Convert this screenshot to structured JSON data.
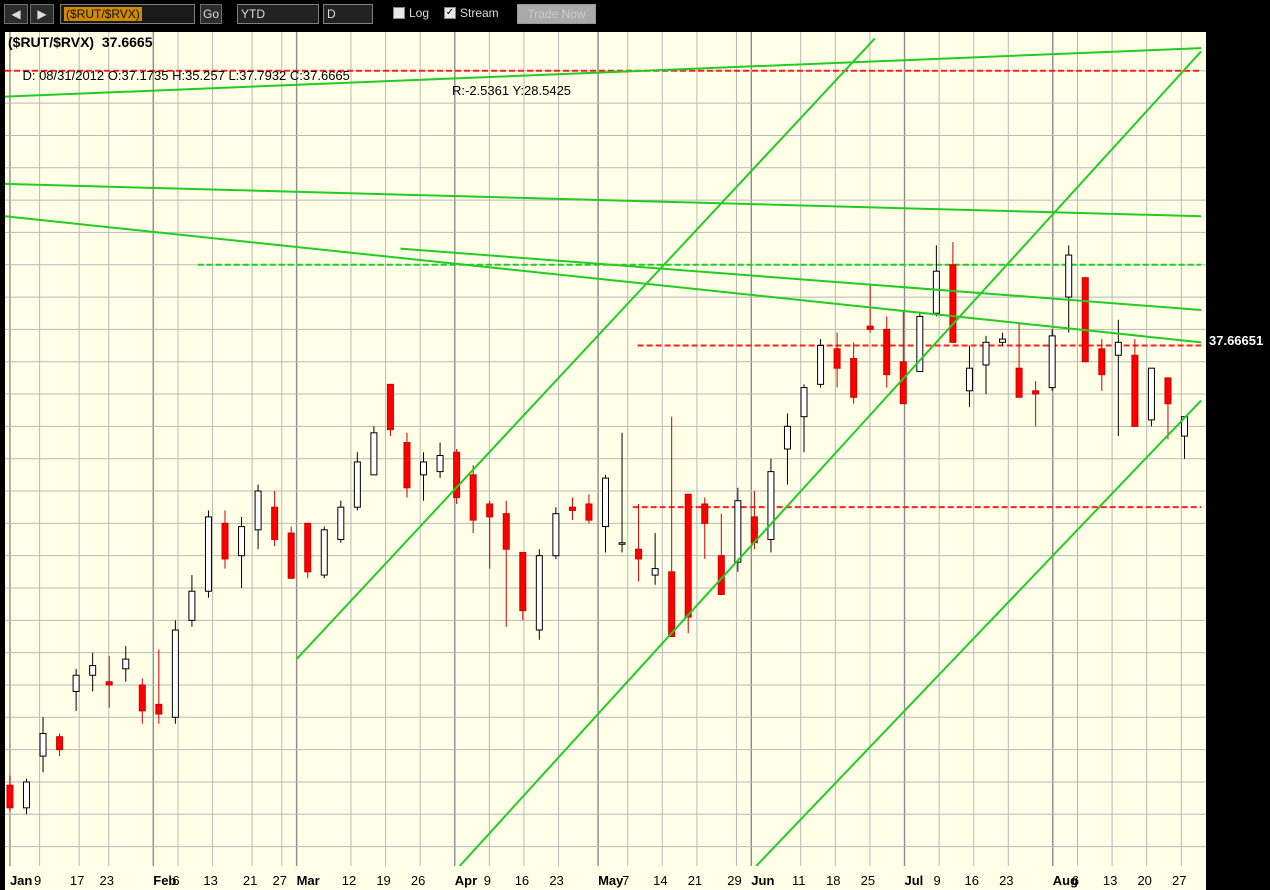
{
  "toolbar": {
    "back_icon": "arrow-left-icon",
    "forward_icon": "arrow-right-icon",
    "symbol_value": "($RUT/$RVX)",
    "go_label": "Go",
    "period_value": "YTD",
    "interval_value": "D",
    "log_label": "Log",
    "log_checked": false,
    "stream_label": "Stream",
    "stream_checked": true,
    "trade_label": "Trade Now"
  },
  "header": {
    "title": "($RUT/$RVX)  37.6665",
    "ohlc": "D: 08/31/2012 O:37.1735 H:35.257 L:37.7932 C:37.6665",
    "ry": "R:-2.5361 Y:28.5425"
  },
  "price_tag": "37.66651",
  "colors": {
    "background": "#FFFFE8",
    "up_candle": "#ffffff",
    "down_candle": "#ff0000",
    "trendline": "#22cc22",
    "support_resistance": "#ff2020",
    "grid": "#b8b8b8"
  },
  "chart_data": {
    "type": "candlestick",
    "ylim": [
      21.4,
      47.2
    ],
    "yticks": [
      22,
      23,
      24,
      25,
      26,
      27,
      28,
      29,
      30,
      31,
      32,
      33,
      34,
      35,
      36,
      37,
      38,
      39,
      40,
      41,
      42,
      43,
      44,
      45,
      46
    ],
    "x_labels": [
      {
        "label": "Jan",
        "date": "2012-01-03",
        "month": true
      },
      {
        "label": "9",
        "date": "2012-01-09",
        "month": false
      },
      {
        "label": "17",
        "date": "2012-01-17",
        "month": false
      },
      {
        "label": "23",
        "date": "2012-01-23",
        "month": false
      },
      {
        "label": "Feb",
        "date": "2012-02-01",
        "month": true
      },
      {
        "label": "6",
        "date": "2012-02-06",
        "month": false
      },
      {
        "label": "13",
        "date": "2012-02-13",
        "month": false
      },
      {
        "label": "21",
        "date": "2012-02-21",
        "month": false
      },
      {
        "label": "27",
        "date": "2012-02-27",
        "month": false
      },
      {
        "label": "Mar",
        "date": "2012-03-01",
        "month": true
      },
      {
        "label": "12",
        "date": "2012-03-12",
        "month": false
      },
      {
        "label": "19",
        "date": "2012-03-19",
        "month": false
      },
      {
        "label": "26",
        "date": "2012-03-26",
        "month": false
      },
      {
        "label": "Apr",
        "date": "2012-04-02",
        "month": true
      },
      {
        "label": "9",
        "date": "2012-04-09",
        "month": false
      },
      {
        "label": "16",
        "date": "2012-04-16",
        "month": false
      },
      {
        "label": "23",
        "date": "2012-04-23",
        "month": false
      },
      {
        "label": "May",
        "date": "2012-05-01",
        "month": true
      },
      {
        "label": "7",
        "date": "2012-05-07",
        "month": false
      },
      {
        "label": "14",
        "date": "2012-05-14",
        "month": false
      },
      {
        "label": "21",
        "date": "2012-05-21",
        "month": false
      },
      {
        "label": "29",
        "date": "2012-05-29",
        "month": false
      },
      {
        "label": "Jun",
        "date": "2012-06-01",
        "month": true
      },
      {
        "label": "11",
        "date": "2012-06-11",
        "month": false
      },
      {
        "label": "18",
        "date": "2012-06-18",
        "month": false
      },
      {
        "label": "25",
        "date": "2012-06-25",
        "month": false
      },
      {
        "label": "Jul",
        "date": "2012-07-02",
        "month": true
      },
      {
        "label": "9",
        "date": "2012-07-09",
        "month": false
      },
      {
        "label": "16",
        "date": "2012-07-16",
        "month": false
      },
      {
        "label": "23",
        "date": "2012-07-23",
        "month": false
      },
      {
        "label": "Aug",
        "date": "2012-08-01",
        "month": true
      },
      {
        "label": "6",
        "date": "2012-08-06",
        "month": false
      },
      {
        "label": "13",
        "date": "2012-08-13",
        "month": false
      },
      {
        "label": "20",
        "date": "2012-08-20",
        "month": false
      },
      {
        "label": "27",
        "date": "2012-08-27",
        "month": false
      }
    ],
    "ohlc_by_week": [
      [
        23.9,
        24.2,
        23.1,
        23.2
      ],
      [
        23.2,
        24.1,
        23.0,
        24.0
      ],
      [
        24.8,
        26.0,
        24.3,
        25.5
      ],
      [
        25.4,
        25.5,
        24.8,
        25.0
      ],
      [
        26.8,
        27.5,
        26.2,
        27.3
      ],
      [
        27.3,
        28.0,
        26.8,
        27.6
      ],
      [
        27.1,
        27.9,
        26.3,
        27.0
      ],
      [
        27.5,
        28.2,
        27.1,
        27.8
      ],
      [
        27.0,
        27.2,
        25.8,
        26.2
      ],
      [
        26.4,
        28.1,
        25.8,
        26.1
      ],
      [
        26.0,
        29.0,
        25.8,
        28.7
      ],
      [
        29.0,
        30.4,
        28.8,
        29.9
      ],
      [
        29.9,
        32.4,
        29.7,
        32.2
      ],
      [
        32.0,
        32.4,
        30.6,
        30.9
      ],
      [
        31.0,
        32.2,
        30.0,
        31.9
      ],
      [
        31.8,
        33.2,
        31.2,
        33.0
      ],
      [
        32.5,
        33.0,
        31.3,
        31.5
      ],
      [
        31.7,
        31.9,
        30.5,
        30.3
      ],
      [
        32.0,
        32.0,
        30.3,
        30.5
      ],
      [
        30.4,
        31.9,
        30.3,
        31.8
      ],
      [
        31.5,
        32.7,
        31.4,
        32.5
      ],
      [
        32.5,
        34.2,
        32.4,
        33.9
      ],
      [
        33.5,
        35.0,
        34.8,
        34.8
      ],
      [
        36.3,
        36.1,
        34.7,
        34.9
      ],
      [
        34.5,
        34.8,
        32.8,
        33.1
      ],
      [
        33.5,
        34.2,
        32.7,
        33.9
      ],
      [
        33.6,
        34.5,
        33.4,
        34.1
      ],
      [
        34.2,
        34.3,
        32.6,
        32.8
      ],
      [
        33.5,
        33.8,
        31.7,
        32.1
      ],
      [
        32.6,
        32.7,
        30.6,
        32.2
      ],
      [
        32.3,
        32.7,
        28.8,
        31.2
      ],
      [
        31.1,
        31.1,
        29.0,
        29.3
      ],
      [
        28.7,
        31.2,
        28.4,
        31.0
      ],
      [
        31.0,
        32.5,
        30.9,
        32.3
      ],
      [
        32.5,
        32.8,
        32.1,
        32.4
      ],
      [
        32.6,
        32.9,
        32.0,
        32.1
      ],
      [
        31.9,
        33.5,
        31.1,
        33.4
      ],
      [
        31.4,
        34.8,
        31.1,
        31.4
      ],
      [
        31.2,
        32.6,
        30.2,
        30.9
      ],
      [
        30.4,
        31.7,
        30.1,
        30.6
      ],
      [
        30.5,
        35.3,
        30.3,
        28.5
      ],
      [
        32.9,
        32.9,
        28.6,
        29.1
      ],
      [
        32.6,
        32.8,
        30.9,
        32.0
      ],
      [
        31.0,
        32.3,
        29.8,
        29.8
      ],
      [
        30.8,
        33.1,
        30.5,
        32.7
      ],
      [
        32.2,
        33.0,
        31.2,
        31.4
      ],
      [
        31.5,
        34.0,
        31.1,
        33.6
      ],
      [
        34.3,
        35.4,
        33.2,
        35.0
      ],
      [
        35.3,
        36.3,
        34.2,
        36.2
      ],
      [
        36.3,
        37.7,
        36.2,
        37.5
      ],
      [
        37.4,
        37.9,
        36.2,
        36.8
      ],
      [
        37.1,
        37.6,
        35.7,
        35.9
      ],
      [
        38.1,
        39.4,
        37.9,
        38.0
      ],
      [
        38.0,
        38.4,
        36.2,
        36.6
      ],
      [
        37.0,
        38.6,
        37.9,
        35.7
      ],
      [
        36.7,
        38.5,
        36.9,
        38.4
      ],
      [
        38.5,
        40.6,
        38.4,
        39.8
      ],
      [
        40.0,
        40.7,
        39.2,
        37.6
      ],
      [
        36.1,
        37.5,
        35.6,
        36.8
      ],
      [
        36.9,
        37.8,
        36.0,
        37.6
      ],
      [
        37.6,
        37.9,
        37.5,
        37.7
      ],
      [
        36.8,
        38.2,
        36.2,
        35.9
      ],
      [
        36.1,
        36.4,
        35.0,
        36.0
      ],
      [
        36.2,
        38.0,
        36.1,
        37.8
      ],
      [
        39.0,
        40.6,
        37.9,
        40.3
      ],
      [
        39.6,
        39.1,
        37.6,
        37.0
      ],
      [
        37.4,
        37.7,
        36.1,
        36.6
      ],
      [
        37.2,
        38.3,
        34.7,
        37.6
      ],
      [
        37.2,
        37.7,
        35.8,
        35.0
      ],
      [
        35.2,
        36.7,
        35.0,
        36.8
      ],
      [
        36.5,
        35.4,
        34.6,
        35.7
      ],
      [
        34.7,
        35.3,
        34.0,
        35.3
      ]
    ],
    "trendlines": [
      {
        "from": [
          "2012-01-02",
          45.2
        ],
        "to": [
          "2012-08-31",
          46.7
        ]
      },
      {
        "from": [
          "2012-01-02",
          42.5
        ],
        "to": [
          "2012-08-31",
          41.5
        ]
      },
      {
        "from": [
          "2012-01-02",
          41.5
        ],
        "to": [
          "2012-08-31",
          37.6
        ]
      },
      {
        "from": [
          "2012-03-22",
          40.5
        ],
        "to": [
          "2012-08-31",
          38.6
        ]
      },
      {
        "from": [
          "2012-03-01",
          27.8
        ],
        "to": [
          "2012-06-26",
          47.0
        ]
      },
      {
        "from": [
          "2012-04-03",
          21.4
        ],
        "to": [
          "2012-08-31",
          46.6
        ]
      },
      {
        "from": [
          "2012-06-02",
          21.4
        ],
        "to": [
          "2012-08-31",
          35.8
        ]
      }
    ],
    "hlines": [
      {
        "y": 46.0,
        "from": "2012-01-02",
        "to": "2012-08-31",
        "color": "red"
      },
      {
        "y": 40.0,
        "from": "2012-02-10",
        "to": "2012-08-31",
        "color": "green"
      },
      {
        "y": 37.5,
        "from": "2012-05-09",
        "to": "2012-08-31",
        "color": "red"
      },
      {
        "y": 32.5,
        "from": "2012-05-08",
        "to": "2012-08-31",
        "color": "red"
      }
    ]
  }
}
